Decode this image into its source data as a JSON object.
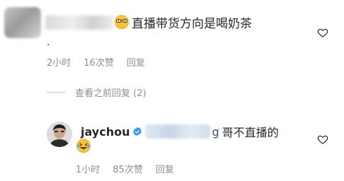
{
  "comment_top": {
    "text": "直播带货方向是喝奶茶",
    "emoji_icon": "nerd-face-emoji-icon",
    "second_line": ".",
    "meta": {
      "time": "2小时",
      "likes": "16次赞",
      "reply": "回复"
    }
  },
  "view_previous": {
    "label": "查看之前回复 (2)"
  },
  "reply": {
    "username": "jaychou",
    "verified_icon": "verified-badge-icon",
    "mention_suffix": "g",
    "text": "哥不直播的",
    "emoji_icon": "laughing-tears-emoji-icon",
    "meta": {
      "time": "1小时",
      "likes": "85次赞",
      "reply": "回复"
    }
  },
  "colors": {
    "text": "#262626",
    "secondary": "#8e8e8e",
    "verified": "#3897f0",
    "mention": "#385185"
  }
}
